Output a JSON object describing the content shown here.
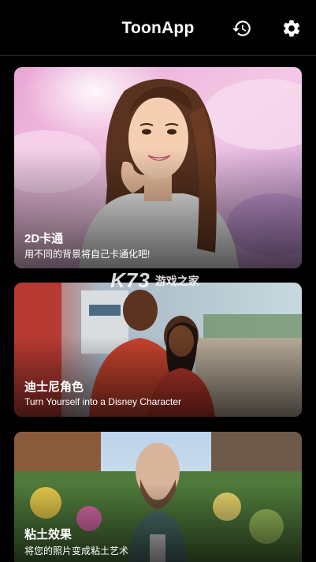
{
  "header": {
    "title": "ToonApp",
    "history_icon": "history-icon",
    "settings_icon": "gear-icon"
  },
  "cards": [
    {
      "title": "2D卡通",
      "subtitle": "用不同的背景将自己卡通化吧!"
    },
    {
      "title": "迪士尼角色",
      "subtitle": "Turn Yourself into a Disney Character"
    },
    {
      "title": "粘土效果",
      "subtitle": "将您的照片变成粘土艺术"
    }
  ],
  "watermark": {
    "logo": "K73",
    "text": "游戏之家"
  }
}
